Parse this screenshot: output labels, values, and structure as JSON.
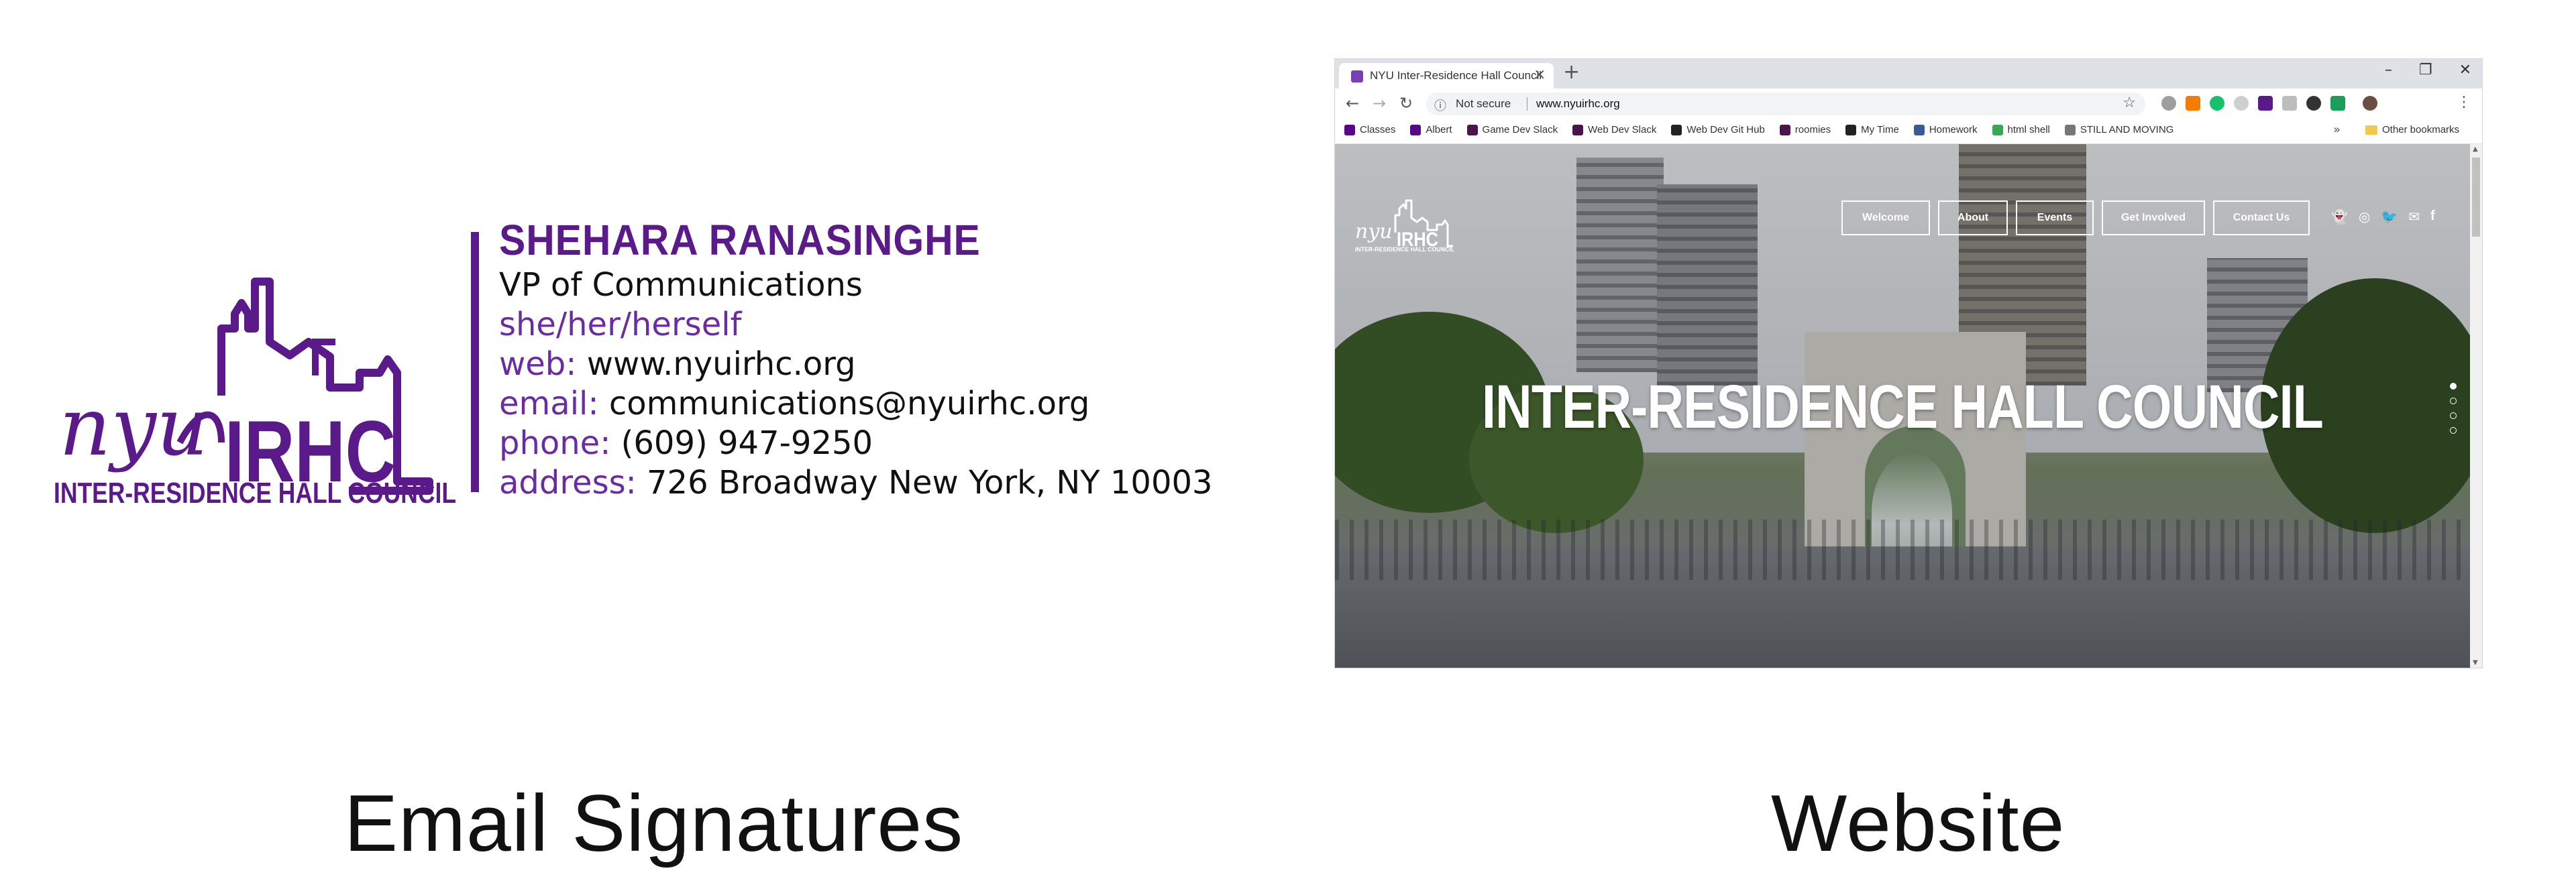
{
  "signature": {
    "name": "SHEHARA RANASINGHE",
    "title": "VP of Communications",
    "pronouns": "she/her/herself",
    "web_label": "web:",
    "web_value": "www.nyuirhc.org",
    "email_label": "email:",
    "email_value": "communications@nyuirhc.org",
    "phone_label": "phone:",
    "phone_value": "(609) 947-9250",
    "address_label": "address:",
    "address_value": "726 Broadway New York, NY 10003",
    "logo_script": "nyu",
    "logo_letters": "IRHC",
    "logo_caption": "INTER-RESIDENCE HALL COUNCIL",
    "brand_color": "#5a1a8a"
  },
  "browser": {
    "tab_title": "NYU Inter-Residence Hall Council",
    "tab_close": "×",
    "new_tab": "+",
    "window_controls": [
      "–",
      "❐",
      "✕"
    ],
    "nav_back": "←",
    "nav_forward": "→",
    "nav_reload": "↻",
    "security_label": "Not secure",
    "url": "www.nyuirhc.org",
    "bookmarks": [
      {
        "label": "Classes",
        "color": "#57068c"
      },
      {
        "label": "Albert",
        "color": "#57068c"
      },
      {
        "label": "Game Dev Slack",
        "color": "#4a154b"
      },
      {
        "label": "Web Dev Slack",
        "color": "#4a154b"
      },
      {
        "label": "Web Dev Git Hub",
        "color": "#222222"
      },
      {
        "label": "roomies",
        "color": "#4a154b"
      },
      {
        "label": "My Time",
        "color": "#222222"
      },
      {
        "label": "Homework",
        "color": "#3b5998"
      },
      {
        "label": "html shell",
        "color": "#3aa757"
      },
      {
        "label": "STILL AND MOVING",
        "color": "#777777"
      }
    ],
    "bookmarks_more": "»",
    "other_bookmarks": "Other bookmarks"
  },
  "site": {
    "logo_script": "nyu",
    "logo_letters": "IRHC",
    "logo_caption": "INTER-RESIDENCE HALL COUNCIL",
    "nav": [
      "Welcome",
      "About",
      "Events",
      "Get Involved",
      "Contact Us"
    ],
    "hero_title": "INTER-RESIDENCE HALL COUNCIL"
  },
  "captions": {
    "left": "Email Signatures",
    "right": "Website"
  }
}
